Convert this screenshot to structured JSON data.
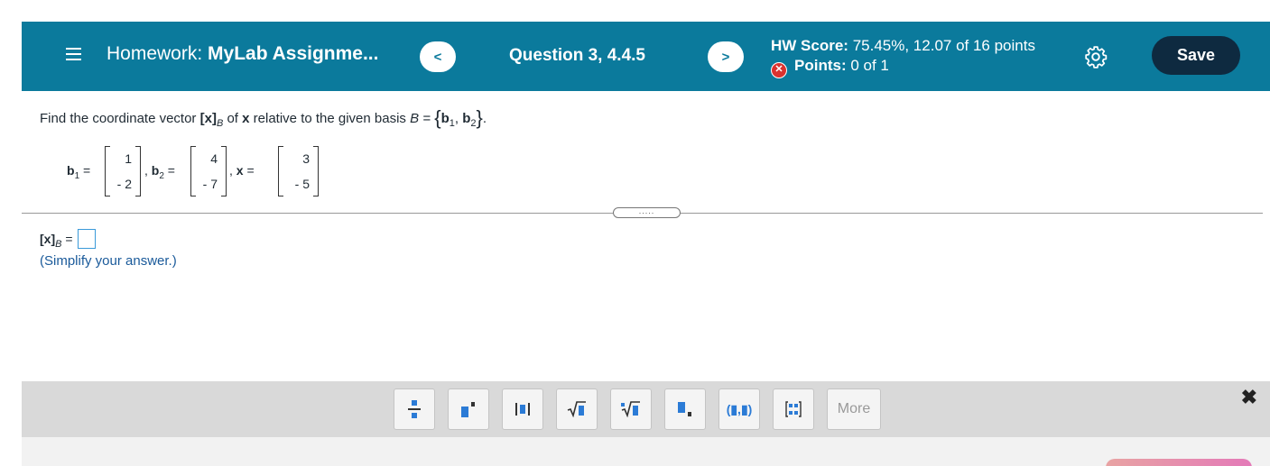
{
  "header": {
    "homework_prefix": "Homework:",
    "assignment_title": "MyLab Assignme...",
    "prev_label": "<",
    "question_title": "Question 3, 4.4.5",
    "next_label": ">",
    "hw_score_label": "HW Score:",
    "hw_score_value": "75.45%, 12.07 of 16 points",
    "points_label": "Points:",
    "points_value": "0 of 1",
    "save_label": "Save"
  },
  "question": {
    "prompt_start": "Find the coordinate vector ",
    "x_bold": "[x]",
    "sub_B": "B",
    "of": " of ",
    "x": "x",
    "relative": " relative to the given basis ",
    "B_eq": "B = ",
    "b1": "b",
    "n1": "1",
    "comma": ", ",
    "b2": "b",
    "n2": "2",
    "end": ".",
    "vectors": {
      "b1_label": "b",
      "b1_sub": "1",
      "b1_values": [
        "1",
        "- 2"
      ],
      "b2_label": "b",
      "b2_sub": "2",
      "b2_values": [
        "4",
        "- 7"
      ],
      "x_label": "x",
      "x_values": [
        "3",
        "- 5"
      ]
    }
  },
  "answer": {
    "label": "[x]",
    "sub": "B",
    "eq": " =",
    "hint": "(Simplify your answer.)"
  },
  "toolbar": {
    "tools": [
      "fraction",
      "superscript",
      "absolute-value",
      "sqrt",
      "nth-root",
      "subscript",
      "ordered-pair",
      "matrix"
    ],
    "ordered_pair_label": "(▮,▮)",
    "more_label": "More",
    "close_label": "✖"
  },
  "colors": {
    "header": "#0b7a9c",
    "save": "#0e2a40",
    "accent": "#2b7bd6",
    "error": "#d9322f"
  }
}
